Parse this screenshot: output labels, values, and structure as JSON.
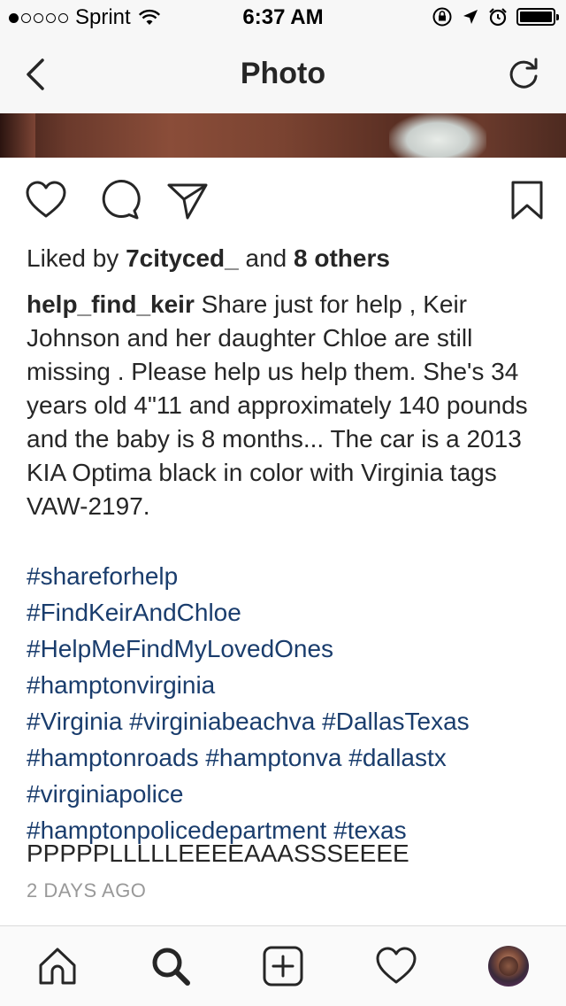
{
  "status_bar": {
    "signal_dots_filled": 1,
    "signal_dots_total": 5,
    "carrier": "Sprint",
    "time": "6:37 AM"
  },
  "nav": {
    "title": "Photo"
  },
  "post": {
    "likes_prefix": "Liked by ",
    "liked_by_user": "7cityced_",
    "likes_middle": " and ",
    "others": "8 others",
    "caption_user": "help_find_keir",
    "caption_text": " Share just for help , Keir Johnson and her daughter Chloe are still missing . Please help us help them. She's 34 years old 4\"11 and approximately 140 pounds and the baby is 8 months... The car is a 2013 KIA Optima black in color with Virginia tags VAW-2197.",
    "hashtag_lines": [
      [
        "#shareforhelp"
      ],
      [
        "#FindKeirAndChloe"
      ],
      [
        "#HelpMeFindMyLovedOnes"
      ],
      [
        "#hamptonvirginia"
      ],
      [
        "#Virginia",
        "#virginiabeachva",
        "#DallasTexas"
      ],
      [
        "#hamptonroads",
        "#hamptonva",
        "#dallastx"
      ],
      [
        "#virginiapolice"
      ],
      [
        "#hamptonpolicedepartment",
        "#texas"
      ]
    ],
    "caption_tail": "PPPPPLLLLLEEEEAAASSSEEEE",
    "timestamp": "2 DAYS AGO"
  },
  "icons": {
    "back": "chevron-left-icon",
    "refresh": "refresh-icon",
    "like": "heart-icon",
    "comment": "comment-icon",
    "share": "paper-plane-icon",
    "save": "bookmark-icon",
    "home": "home-icon",
    "search": "search-icon",
    "add": "plus-square-icon",
    "activity": "heart-icon",
    "profile": "avatar"
  },
  "colors": {
    "hashtag": "#1a3d6d",
    "text": "#262626",
    "timestamp": "#999999",
    "bar_bg": "#f7f7f7"
  }
}
